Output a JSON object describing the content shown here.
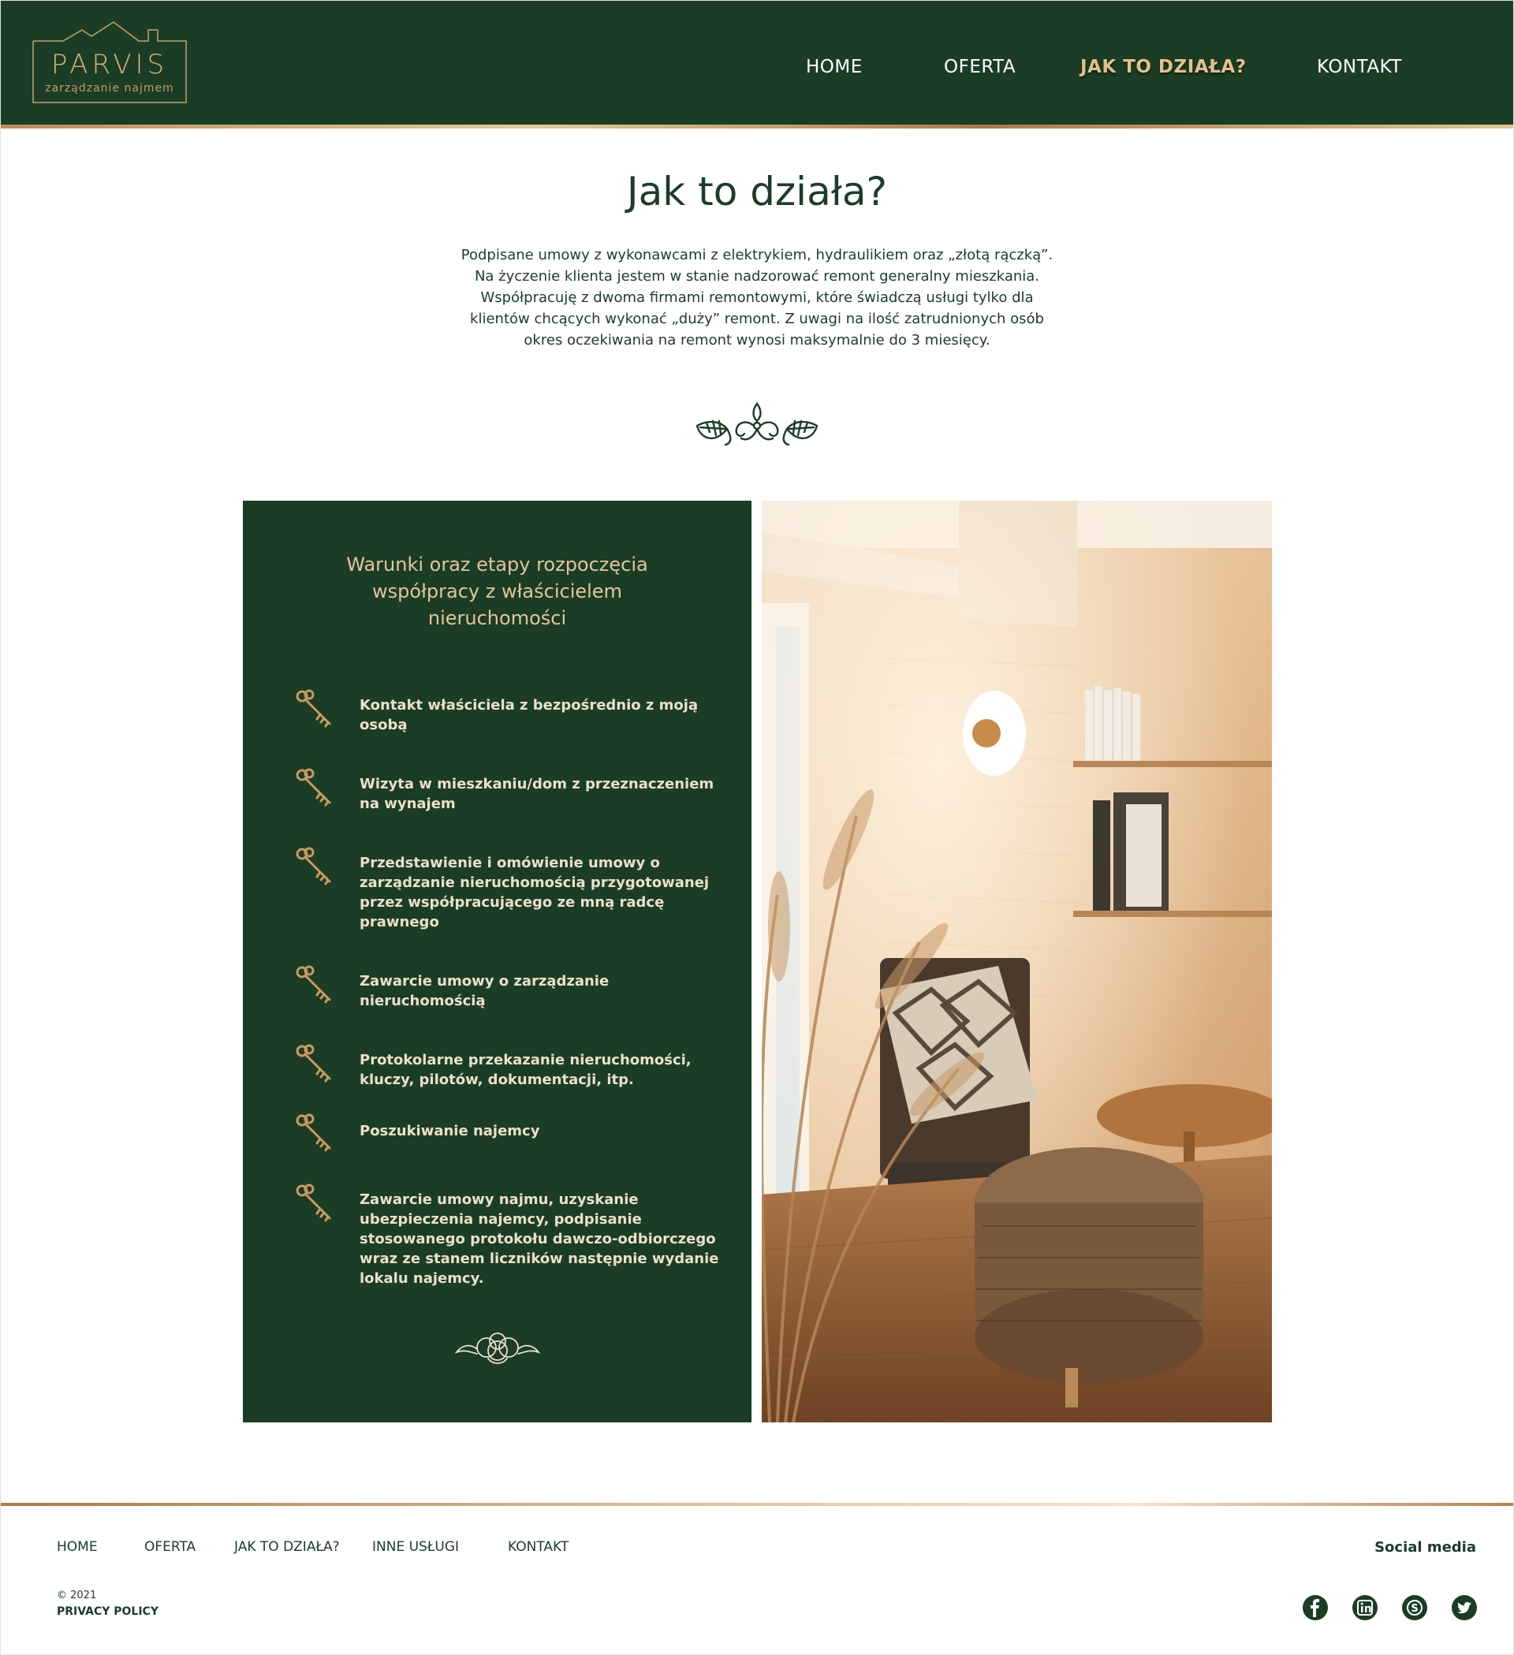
{
  "brand": {
    "name": "PARVIS",
    "tagline": "zarządzanie najmem"
  },
  "nav": {
    "items": [
      {
        "label": "HOME"
      },
      {
        "label": "OFERTA"
      },
      {
        "label": "JAK TO DZIAŁA?",
        "active": true
      },
      {
        "label": "KONTAKT"
      }
    ]
  },
  "intro": {
    "title": "Jak to działa?",
    "lines": [
      "Podpisane umowy z wykonawcami z elektrykiem, hydraulikiem oraz „złotą rączką”.",
      "Na życzenie klienta jestem w stanie nadzorować remont generalny mieszkania.",
      "Współpracuję z dwoma firmami remontowymi, które świadczą usługi tylko dla",
      "klientów chcących wykonać „duży” remont. Z uwagi na ilość zatrudnionych osób",
      "okres oczekiwania na remont wynosi maksymalnie do 3 miesięcy."
    ]
  },
  "steps_panel": {
    "title_lines": [
      "Warunki oraz etapy rozpoczęcia",
      "współpracy z właścicielem",
      "nieruchomości"
    ],
    "icon": "key-icon",
    "steps": [
      {
        "lines": [
          "Kontakt właściciela z bezpośrednio z moją",
          "osobą"
        ]
      },
      {
        "lines": [
          "Wizyta w mieszkaniu/dom z przeznaczeniem",
          "na wynajem"
        ]
      },
      {
        "lines": [
          "Przedstawienie i omówienie umowy o",
          "zarządzanie nieruchomością przygotowanej",
          "przez współpracującego ze mną radcę",
          "prawnego"
        ]
      },
      {
        "lines": [
          "Zawarcie umowy o zarządzanie",
          "nieruchomością"
        ]
      },
      {
        "lines": [
          "Protokolarne przekazanie nieruchomości,",
          "kluczy, pilotów, dokumentacji, itp."
        ]
      },
      {
        "lines": [
          "Poszukiwanie najemcy"
        ]
      },
      {
        "lines": [
          "Zawarcie umowy najmu, uzyskanie",
          "ubezpieczenia najemcy, podpisanie",
          "stosowanego protokołu dawczo-odbiorczego",
          "wraz ze stanem liczników następnie wydanie",
          "lokalu najemcy."
        ]
      }
    ]
  },
  "footer": {
    "links": [
      {
        "label": "HOME"
      },
      {
        "label": "OFERTA"
      },
      {
        "label": "JAK TO DZIAŁA?"
      },
      {
        "label": "INNE USŁUGI"
      },
      {
        "label": "KONTAKT"
      }
    ],
    "social_label": "Social media",
    "copyright": "© 2021",
    "privacy": "PRIVACY POLICY",
    "social_icons": [
      "facebook-icon",
      "linkedin-icon",
      "skype-icon",
      "twitter-icon"
    ]
  },
  "colors": {
    "primary_green": "#1b3d26",
    "gold": "#d9b27a",
    "panel_text": "#ebe0c8",
    "background": "#ffffff"
  }
}
